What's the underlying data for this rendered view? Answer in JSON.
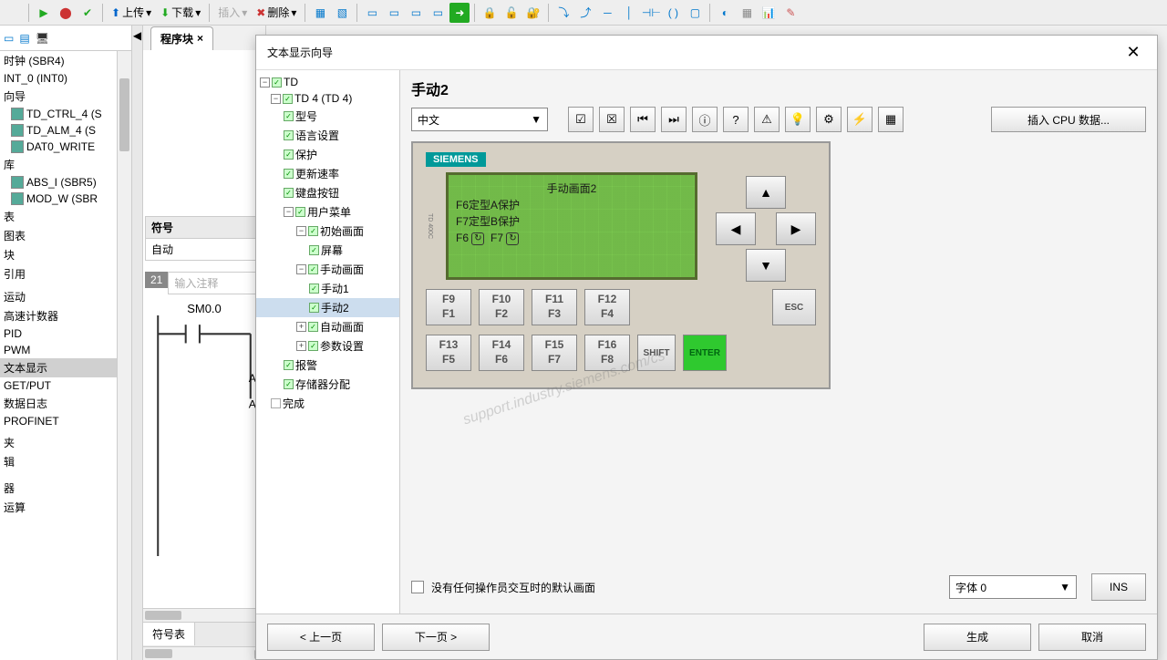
{
  "toolbar": {
    "upload": "上传",
    "download": "下载",
    "insert": "插入",
    "delete": "删除"
  },
  "leftTree": {
    "items": [
      "时钟 (SBR4)",
      "INT_0 (INT0)",
      "向导"
    ],
    "subs": [
      "TD_CTRL_4 (S",
      "TD_ALM_4 (S",
      "DAT0_WRITE"
    ],
    "lib": "库",
    "libSubs": [
      "ABS_I (SBR5)",
      "MOD_W (SBR"
    ],
    "rest": [
      "表",
      "图表",
      "块",
      "引用",
      "",
      "运动",
      "高速计数器",
      "PID",
      "PWM",
      "文本显示",
      "GET/PUT",
      "数据日志",
      "PROFINET",
      "",
      "夹",
      "辑",
      "",
      "",
      "器",
      "运算"
    ]
  },
  "mid": {
    "tab": "程序块",
    "symLabel": "符号",
    "symVal": "自动",
    "netNum": "21",
    "commentPlaceholder": "输入注释",
    "contact": "SM0.0",
    "botTab": "符号表"
  },
  "dialog": {
    "title": "文本显示向导",
    "tree": {
      "td": "TD",
      "td4": "TD 4 (TD 4)",
      "model": "型号",
      "lang": "语言设置",
      "prot": "保护",
      "upd": "更新速率",
      "kbd": "键盘按钮",
      "menu": "用户菜单",
      "init": "初始画面",
      "screen": "屏幕",
      "manual": "手动画面",
      "m1": "手动1",
      "m2": "手动2",
      "auto": "自动画面",
      "param": "参数设置",
      "alarm": "报警",
      "store": "存储器分配",
      "done": "完成"
    },
    "page": {
      "title": "手动2",
      "lang": "中文",
      "cpuBtn": "插入 CPU 数据...",
      "lcd": {
        "l1": "手动画面2",
        "l2": "F6定型A保护",
        "l3": "F7定型B保护",
        "l4a": "F6",
        "l4b": "F7"
      },
      "brand": "SIEMENS",
      "side": "TD 400C",
      "fkeys": [
        [
          "F9",
          "F1"
        ],
        [
          "F10",
          "F2"
        ],
        [
          "F11",
          "F3"
        ],
        [
          "F12",
          "F4"
        ],
        [
          "F13",
          "F5"
        ],
        [
          "F14",
          "F6"
        ],
        [
          "F15",
          "F7"
        ],
        [
          "F16",
          "F8"
        ]
      ],
      "shift": "SHIFT",
      "enter": "ENTER",
      "esc": "ESC",
      "defaultChk": "没有任何操作员交互时的默认画面",
      "font": "字体 0",
      "ins": "INS",
      "watermark": "support.industry.siemens.com/cs"
    },
    "foot": {
      "prev": "< 上一页",
      "next": "下一页 >",
      "gen": "生成",
      "cancel": "取消"
    }
  }
}
